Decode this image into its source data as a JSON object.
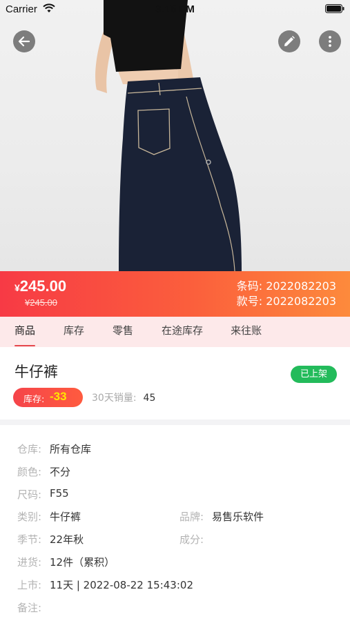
{
  "status_bar": {
    "carrier": "Carrier",
    "time": "3:15 PM"
  },
  "nav": {
    "back_icon": "arrow-left-icon",
    "edit_icon": "pencil-icon",
    "more_icon": "more-vertical-icon"
  },
  "price": {
    "currency": "¥",
    "current": "245.00",
    "original": "¥245.00"
  },
  "codes": {
    "barcode_label": "条码:",
    "barcode": "2022082203",
    "style_label": "款号:",
    "style_no": "2022082203"
  },
  "tabs": [
    "商品",
    "库存",
    "零售",
    "在途库存",
    "来往账"
  ],
  "product": {
    "name": "牛仔裤",
    "status": "已上架",
    "stock_label": "库存:",
    "stock_value": "-33",
    "sales_label": "30天销量:",
    "sales_value": "45"
  },
  "details": {
    "warehouse_label": "仓库:",
    "warehouse": "所有仓库",
    "color_label": "颜色:",
    "color": "不分",
    "size_label": "尺码:",
    "size": "F55",
    "category_label": "类别:",
    "category": "牛仔裤",
    "brand_label": "品牌:",
    "brand": "易售乐软件",
    "season_label": "季节:",
    "season": "22年秋",
    "material_label": "成分:",
    "material": "",
    "purchase_label": "进货:",
    "purchase": "12件（累积）",
    "listed_label": "上市:",
    "listed": "11天 | 2022-08-22 15:43:02",
    "remark_label": "备注:",
    "remark": ""
  },
  "colors": {
    "accent_red": "#f73a45",
    "accent_orange": "#fd8a3c",
    "badge_green": "#23bb5b",
    "tab_bg": "#fde9ea",
    "stock_value_yellow": "#ffe600"
  }
}
